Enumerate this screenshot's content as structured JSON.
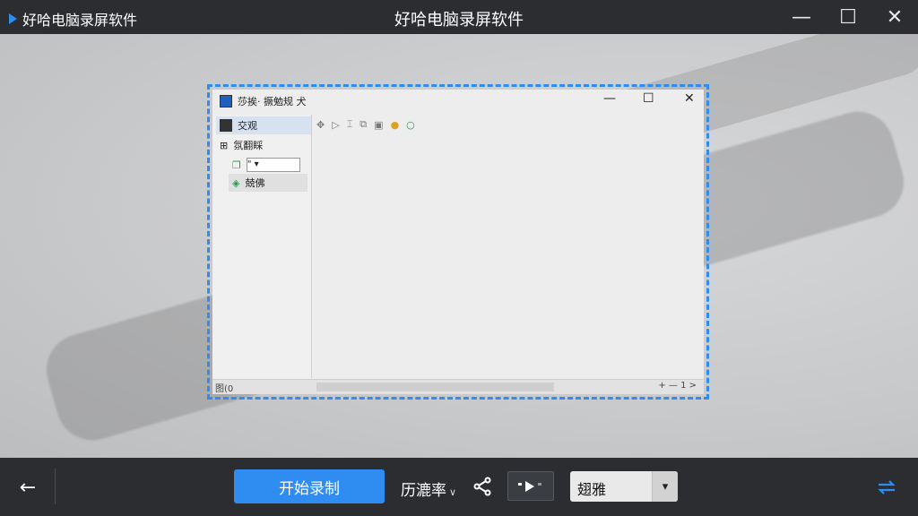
{
  "titlebar": {
    "app_name": "好哈电脑录屏软件",
    "center_title": "好哈电脑录屏软件",
    "minimize": "—",
    "maximize": "☐",
    "close": "✕"
  },
  "captured_window": {
    "title_text": "莎挨· 撅勉规 犬",
    "minimize": "—",
    "maximize": "☐",
    "close": "✕",
    "sidebar": [
      {
        "label": "交观"
      },
      {
        "label": "氛翻睬"
      },
      {
        "label": "\""
      },
      {
        "label": "兢佛"
      }
    ],
    "status_left": "图(0",
    "status_right": "+ — 1 >"
  },
  "bottombar": {
    "back_icon": "arrow-left",
    "record_label": "开始录制",
    "fps_label": "历漉率",
    "select_value": "翅雅",
    "accent_color": "#2f8cf0"
  }
}
